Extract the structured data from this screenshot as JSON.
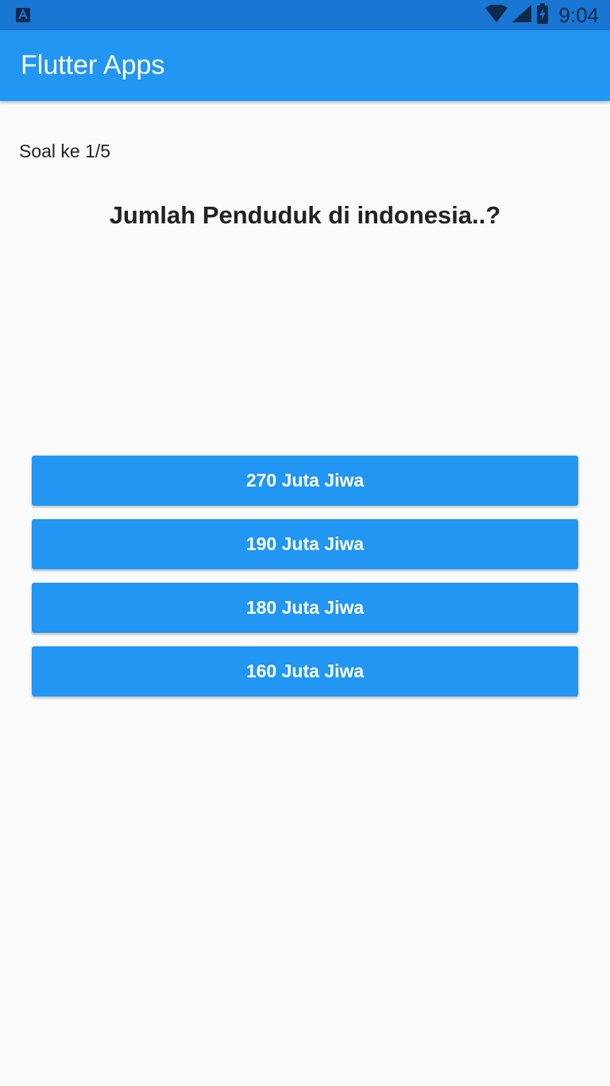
{
  "status_bar": {
    "time": "9:04",
    "left_icon": "a-notification-icon",
    "icons": [
      "wifi-icon",
      "signal-icon",
      "battery-icon"
    ],
    "background": "#1976d2"
  },
  "app_bar": {
    "title": "Flutter Apps",
    "color": "#2196f3"
  },
  "quiz": {
    "counter": "Soal ke 1/5",
    "question": "Jumlah Penduduk di indonesia..?",
    "answers": [
      {
        "label": "270 Juta Jiwa"
      },
      {
        "label": "190 Juta Jiwa"
      },
      {
        "label": "180 Juta Jiwa"
      },
      {
        "label": "160 Juta Jiwa"
      }
    ]
  },
  "colors": {
    "accent": "#2196f3",
    "background": "#fafafa",
    "text": "#222222"
  }
}
